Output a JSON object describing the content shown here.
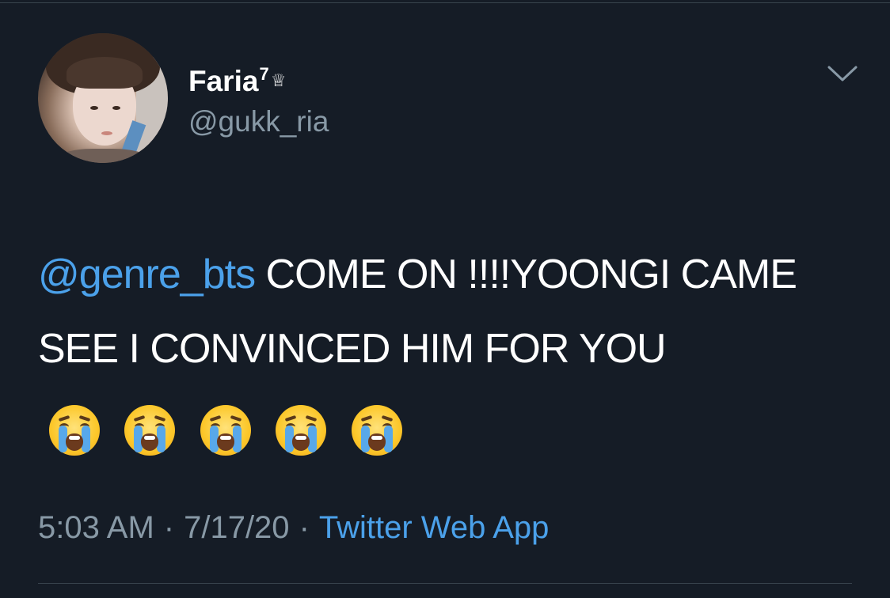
{
  "author": {
    "display_name": "Faria",
    "name_superscript": "7",
    "name_badge": "♕",
    "handle": "@gukk_ria",
    "avatar_icon": "profile-photo"
  },
  "menu": {
    "icon": "chevron-down-icon"
  },
  "tweet": {
    "mention": "@genre_bts",
    "text": " COME ON !!!!YOONGI CAME SEE I CONVINCED HIM FOR YOU",
    "emoji": [
      "loudly-crying-face",
      "loudly-crying-face",
      "loudly-crying-face",
      "loudly-crying-face",
      "loudly-crying-face"
    ]
  },
  "meta": {
    "time": "5:03 AM",
    "separator": "·",
    "date": "7/17/20",
    "source": "Twitter Web App"
  },
  "colors": {
    "background": "#151c26",
    "text": "#ffffff",
    "secondary_text": "#8899a6",
    "link": "#4ba1ea",
    "divider": "#38444d"
  }
}
